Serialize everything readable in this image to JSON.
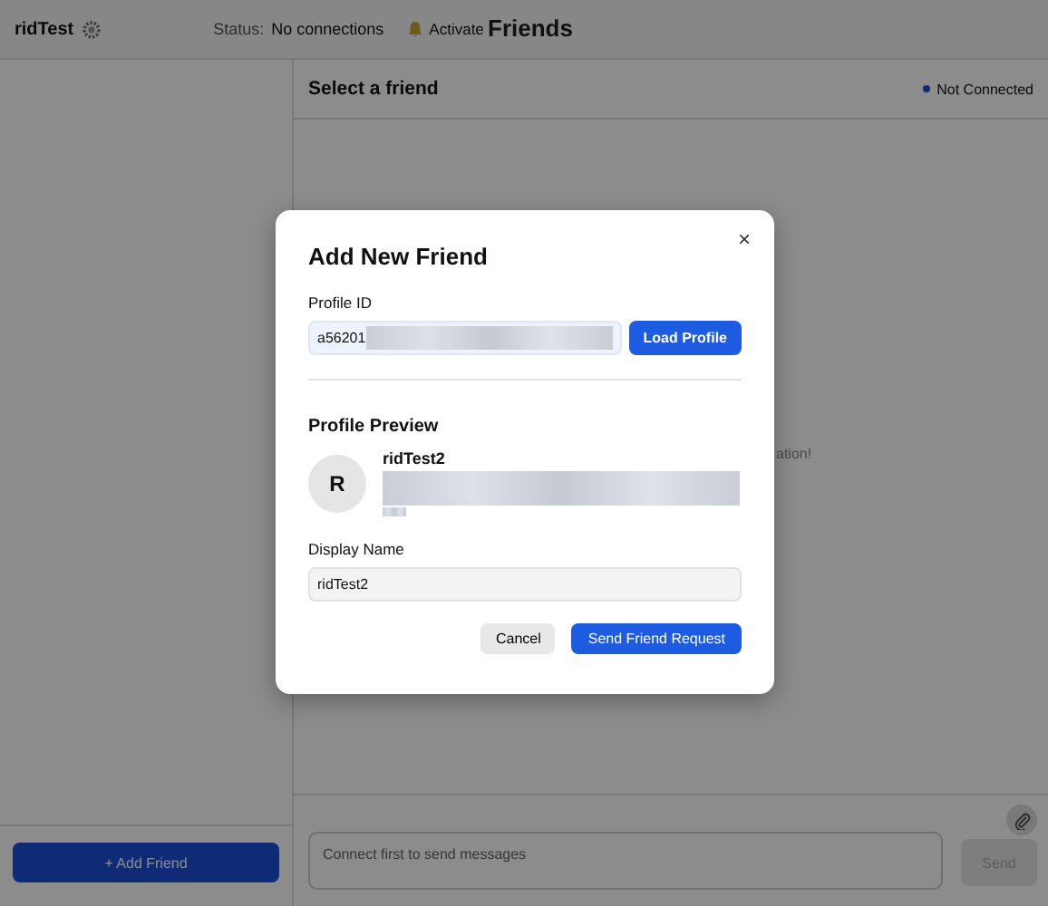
{
  "top_bar": {
    "username": "ridTest",
    "status_label": "Status:",
    "status_value": "No connections",
    "notifications": "Activate",
    "title": "Friends"
  },
  "sidebar": {
    "add_button": "+ Add Friend"
  },
  "chat": {
    "title": "Select a friend",
    "connection": "Not Connected",
    "connected": false,
    "empty_hint": "ation!",
    "composer_placeholder": "Connect first to send messages",
    "send_button": "Send",
    "send_disabled": true
  },
  "dialog": {
    "title": "Add New Friend",
    "close": "×",
    "profile_id_label": "Profile ID",
    "profile_id_value": "a56201",
    "load_button": "Load Profile",
    "preview_heading": "Profile Preview",
    "avatar_letter": "R",
    "preview_name": "ridTest2",
    "display_name_label": "Display Name",
    "display_name_value": "ridTest2",
    "cancel_button": "Cancel",
    "submit_button": "Send Friend Request"
  }
}
